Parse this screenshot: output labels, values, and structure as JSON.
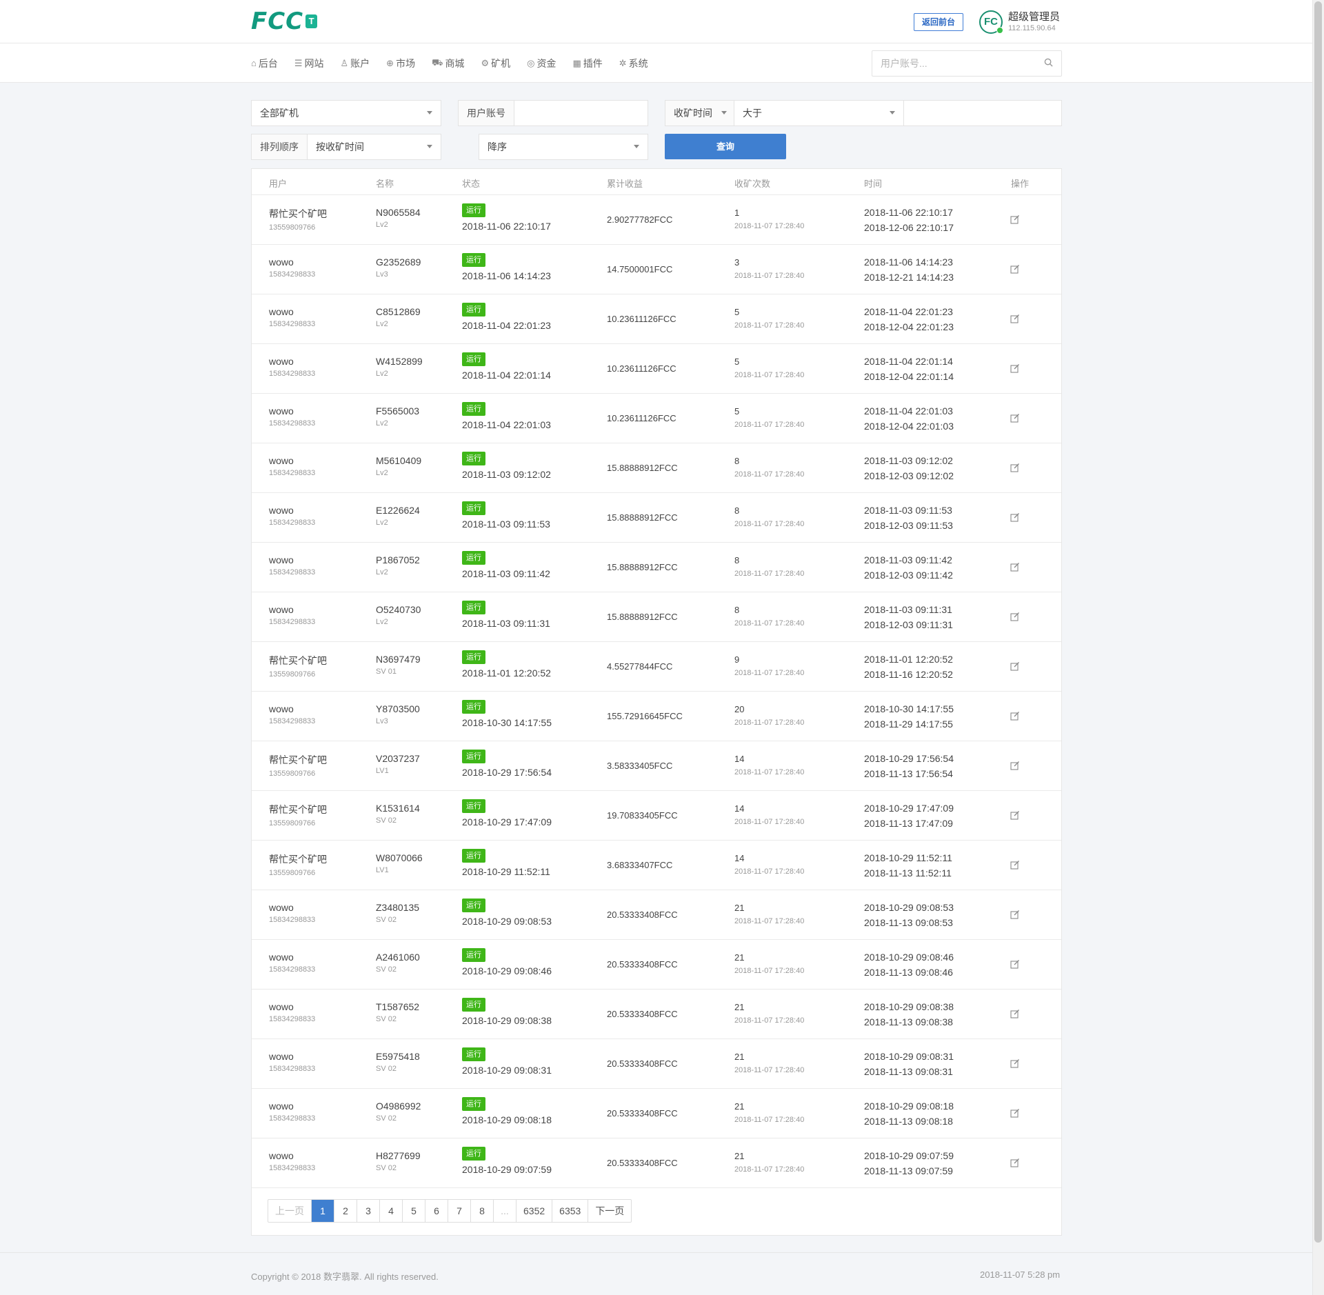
{
  "header": {
    "logo_text": "FCC",
    "logo_badge": "T",
    "frontend_label": "返回前台",
    "admin_avatar": "FC",
    "admin_name": "超级管理员",
    "admin_ip": "112.115.90.64"
  },
  "nav": {
    "items": [
      {
        "label": "后台",
        "icon": "home-icon"
      },
      {
        "label": "网站",
        "icon": "list-icon"
      },
      {
        "label": "账户",
        "icon": "users-icon"
      },
      {
        "label": "市场",
        "icon": "globe-icon"
      },
      {
        "label": "商城",
        "icon": "cart-icon"
      },
      {
        "label": "矿机",
        "icon": "chip-icon"
      },
      {
        "label": "资金",
        "icon": "coin-icon"
      },
      {
        "label": "插件",
        "icon": "grid-icon"
      },
      {
        "label": "系统",
        "icon": "gear-icon"
      }
    ],
    "search_placeholder": "用户账号..."
  },
  "filters": {
    "machine_select": "全部矿机",
    "account_label": "用户账号",
    "account_value": "",
    "time_field": "收矿时间",
    "compare": "大于",
    "time_value": "",
    "sort_label": "排列顺序",
    "sort_by": "按收矿时间",
    "sort_dir": "降序",
    "query_button": "查询"
  },
  "table": {
    "headers": [
      "用户",
      "名称",
      "状态",
      "累计收益",
      "收矿次数",
      "时间",
      "操作"
    ],
    "rows": [
      {
        "user": "帮忙买个矿吧",
        "phone": "13559809766",
        "name": "N9065584",
        "level": "Lv2",
        "status": "运行",
        "status_time": "2018-11-06 22:10:17",
        "income": "2.90277782FCC",
        "count": "1",
        "count_time": "2018-11-07 17:28:40",
        "start": "2018-11-06 22:10:17",
        "end": "2018-12-06 22:10:17"
      },
      {
        "user": "wowo",
        "phone": "15834298833",
        "name": "G2352689",
        "level": "Lv3",
        "status": "运行",
        "status_time": "2018-11-06 14:14:23",
        "income": "14.7500001FCC",
        "count": "3",
        "count_time": "2018-11-07 17:28:40",
        "start": "2018-11-06 14:14:23",
        "end": "2018-12-21 14:14:23"
      },
      {
        "user": "wowo",
        "phone": "15834298833",
        "name": "C8512869",
        "level": "Lv2",
        "status": "运行",
        "status_time": "2018-11-04 22:01:23",
        "income": "10.23611126FCC",
        "count": "5",
        "count_time": "2018-11-07 17:28:40",
        "start": "2018-11-04 22:01:23",
        "end": "2018-12-04 22:01:23"
      },
      {
        "user": "wowo",
        "phone": "15834298833",
        "name": "W4152899",
        "level": "Lv2",
        "status": "运行",
        "status_time": "2018-11-04 22:01:14",
        "income": "10.23611126FCC",
        "count": "5",
        "count_time": "2018-11-07 17:28:40",
        "start": "2018-11-04 22:01:14",
        "end": "2018-12-04 22:01:14"
      },
      {
        "user": "wowo",
        "phone": "15834298833",
        "name": "F5565003",
        "level": "Lv2",
        "status": "运行",
        "status_time": "2018-11-04 22:01:03",
        "income": "10.23611126FCC",
        "count": "5",
        "count_time": "2018-11-07 17:28:40",
        "start": "2018-11-04 22:01:03",
        "end": "2018-12-04 22:01:03"
      },
      {
        "user": "wowo",
        "phone": "15834298833",
        "name": "M5610409",
        "level": "Lv2",
        "status": "运行",
        "status_time": "2018-11-03 09:12:02",
        "income": "15.88888912FCC",
        "count": "8",
        "count_time": "2018-11-07 17:28:40",
        "start": "2018-11-03 09:12:02",
        "end": "2018-12-03 09:12:02"
      },
      {
        "user": "wowo",
        "phone": "15834298833",
        "name": "E1226624",
        "level": "Lv2",
        "status": "运行",
        "status_time": "2018-11-03 09:11:53",
        "income": "15.88888912FCC",
        "count": "8",
        "count_time": "2018-11-07 17:28:40",
        "start": "2018-11-03 09:11:53",
        "end": "2018-12-03 09:11:53"
      },
      {
        "user": "wowo",
        "phone": "15834298833",
        "name": "P1867052",
        "level": "Lv2",
        "status": "运行",
        "status_time": "2018-11-03 09:11:42",
        "income": "15.88888912FCC",
        "count": "8",
        "count_time": "2018-11-07 17:28:40",
        "start": "2018-11-03 09:11:42",
        "end": "2018-12-03 09:11:42"
      },
      {
        "user": "wowo",
        "phone": "15834298833",
        "name": "O5240730",
        "level": "Lv2",
        "status": "运行",
        "status_time": "2018-11-03 09:11:31",
        "income": "15.88888912FCC",
        "count": "8",
        "count_time": "2018-11-07 17:28:40",
        "start": "2018-11-03 09:11:31",
        "end": "2018-12-03 09:11:31"
      },
      {
        "user": "帮忙买个矿吧",
        "phone": "13559809766",
        "name": "N3697479",
        "level": "SV 01",
        "status": "运行",
        "status_time": "2018-11-01 12:20:52",
        "income": "4.55277844FCC",
        "count": "9",
        "count_time": "2018-11-07 17:28:40",
        "start": "2018-11-01 12:20:52",
        "end": "2018-11-16 12:20:52"
      },
      {
        "user": "wowo",
        "phone": "15834298833",
        "name": "Y8703500",
        "level": "Lv3",
        "status": "运行",
        "status_time": "2018-10-30 14:17:55",
        "income": "155.72916645FCC",
        "count": "20",
        "count_time": "2018-11-07 17:28:40",
        "start": "2018-10-30 14:17:55",
        "end": "2018-11-29 14:17:55"
      },
      {
        "user": "帮忙买个矿吧",
        "phone": "13559809766",
        "name": "V2037237",
        "level": "LV1",
        "status": "运行",
        "status_time": "2018-10-29 17:56:54",
        "income": "3.58333405FCC",
        "count": "14",
        "count_time": "2018-11-07 17:28:40",
        "start": "2018-10-29 17:56:54",
        "end": "2018-11-13 17:56:54"
      },
      {
        "user": "帮忙买个矿吧",
        "phone": "13559809766",
        "name": "K1531614",
        "level": "SV 02",
        "status": "运行",
        "status_time": "2018-10-29 17:47:09",
        "income": "19.70833405FCC",
        "count": "14",
        "count_time": "2018-11-07 17:28:40",
        "start": "2018-10-29 17:47:09",
        "end": "2018-11-13 17:47:09"
      },
      {
        "user": "帮忙买个矿吧",
        "phone": "13559809766",
        "name": "W8070066",
        "level": "LV1",
        "status": "运行",
        "status_time": "2018-10-29 11:52:11",
        "income": "3.68333407FCC",
        "count": "14",
        "count_time": "2018-11-07 17:28:40",
        "start": "2018-10-29 11:52:11",
        "end": "2018-11-13 11:52:11"
      },
      {
        "user": "wowo",
        "phone": "15834298833",
        "name": "Z3480135",
        "level": "SV 02",
        "status": "运行",
        "status_time": "2018-10-29 09:08:53",
        "income": "20.53333408FCC",
        "count": "21",
        "count_time": "2018-11-07 17:28:40",
        "start": "2018-10-29 09:08:53",
        "end": "2018-11-13 09:08:53"
      },
      {
        "user": "wowo",
        "phone": "15834298833",
        "name": "A2461060",
        "level": "SV 02",
        "status": "运行",
        "status_time": "2018-10-29 09:08:46",
        "income": "20.53333408FCC",
        "count": "21",
        "count_time": "2018-11-07 17:28:40",
        "start": "2018-10-29 09:08:46",
        "end": "2018-11-13 09:08:46"
      },
      {
        "user": "wowo",
        "phone": "15834298833",
        "name": "T1587652",
        "level": "SV 02",
        "status": "运行",
        "status_time": "2018-10-29 09:08:38",
        "income": "20.53333408FCC",
        "count": "21",
        "count_time": "2018-11-07 17:28:40",
        "start": "2018-10-29 09:08:38",
        "end": "2018-11-13 09:08:38"
      },
      {
        "user": "wowo",
        "phone": "15834298833",
        "name": "E5975418",
        "level": "SV 02",
        "status": "运行",
        "status_time": "2018-10-29 09:08:31",
        "income": "20.53333408FCC",
        "count": "21",
        "count_time": "2018-11-07 17:28:40",
        "start": "2018-10-29 09:08:31",
        "end": "2018-11-13 09:08:31"
      },
      {
        "user": "wowo",
        "phone": "15834298833",
        "name": "O4986992",
        "level": "SV 02",
        "status": "运行",
        "status_time": "2018-10-29 09:08:18",
        "income": "20.53333408FCC",
        "count": "21",
        "count_time": "2018-11-07 17:28:40",
        "start": "2018-10-29 09:08:18",
        "end": "2018-11-13 09:08:18"
      },
      {
        "user": "wowo",
        "phone": "15834298833",
        "name": "H8277699",
        "level": "SV 02",
        "status": "运行",
        "status_time": "2018-10-29 09:07:59",
        "income": "20.53333408FCC",
        "count": "21",
        "count_time": "2018-11-07 17:28:40",
        "start": "2018-10-29 09:07:59",
        "end": "2018-11-13 09:07:59"
      }
    ]
  },
  "pagination": {
    "prev": "上一页",
    "pages": [
      "1",
      "2",
      "3",
      "4",
      "5",
      "6",
      "7",
      "8",
      "...",
      "6352",
      "6353"
    ],
    "active": "1",
    "next": "下一页"
  },
  "footer": {
    "copyright": "Copyright © 2018 数字翡翠. All rights reserved.",
    "time": "2018-11-07 5:28 pm"
  },
  "colors": {
    "brand": "#129a7f",
    "primary": "#3f7fd0",
    "status_running": "#3fb618"
  }
}
